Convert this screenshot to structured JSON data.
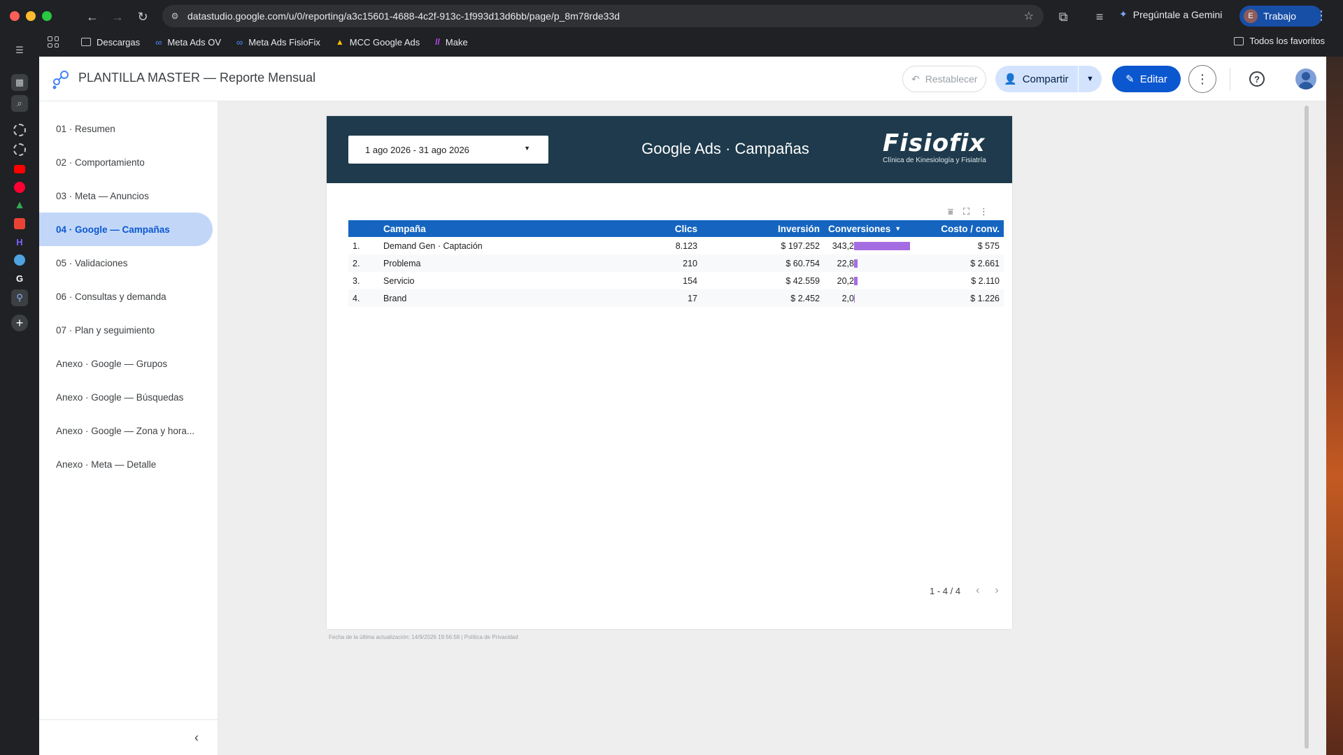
{
  "browser": {
    "url": "datastudio.google.com/u/0/reporting/a3c15601-4688-4c2f-913c-1f993d13d6bb/page/p_8m78rde33d",
    "gemini_label": "Pregúntale a Gemini",
    "profile_initial": "E",
    "profile_label": "Trabajo",
    "bookmarks": [
      "Descargas",
      "Meta Ads OV",
      "Meta Ads FisioFix",
      "MCC Google Ads",
      "Make"
    ],
    "all_bookmarks_label": "Todos los favoritos"
  },
  "topbar": {
    "title": "PLANTILLA MASTER — Reporte Mensual",
    "reset_label": "Restablecer",
    "share_label": "Compartir",
    "edit_label": "Editar"
  },
  "pages": [
    "01 · Resumen",
    "02 · Comportamiento",
    "03 · Meta — Anuncios",
    "04 · Google — Campañas",
    "05 · Validaciones",
    "06 · Consultas y demanda",
    "07 · Plan y seguimiento",
    "Anexo · Google — Grupos",
    "Anexo · Google — Búsquedas",
    "Anexo · Google — Zona y hora...",
    "Anexo · Meta — Detalle"
  ],
  "active_page_index": 3,
  "report": {
    "date_range": "1 ago 2026 - 31 ago 2026",
    "header_title": "Google Ads · Campañas",
    "brand_name": "Fisiofix",
    "brand_subtitle": "Clínica de Kinesiología y Fisiatría",
    "footer_note": "Fecha de la última actualización: 14/9/2026 19:56:58 | Política de Privacidad",
    "pagination": "1 - 4 / 4"
  },
  "table": {
    "columns": [
      "Campaña",
      "Clics",
      "Inversión",
      "Conversiones",
      "Costo / conv."
    ],
    "sort_indicator": "▼",
    "bar_color": "#a56de2",
    "header_color": "#1565c0",
    "rows": [
      {
        "idx": "1.",
        "campaign": "Demand Gen · Captación",
        "clicks": "8.123",
        "investment": "$ 197.252",
        "conversions": "343,2",
        "conv_value": 343.2,
        "cost_per_conv": "$ 575"
      },
      {
        "idx": "2.",
        "campaign": "Problema",
        "clicks": "210",
        "investment": "$ 60.754",
        "conversions": "22,8",
        "conv_value": 22.8,
        "cost_per_conv": "$ 2.661"
      },
      {
        "idx": "3.",
        "campaign": "Servicio",
        "clicks": "154",
        "investment": "$ 42.559",
        "conversions": "20,2",
        "conv_value": 20.2,
        "cost_per_conv": "$ 2.110"
      },
      {
        "idx": "4.",
        "campaign": "Brand",
        "clicks": "17",
        "investment": "$ 2.452",
        "conversions": "2,0",
        "conv_value": 2.0,
        "cost_per_conv": "$ 1.226"
      }
    ]
  }
}
